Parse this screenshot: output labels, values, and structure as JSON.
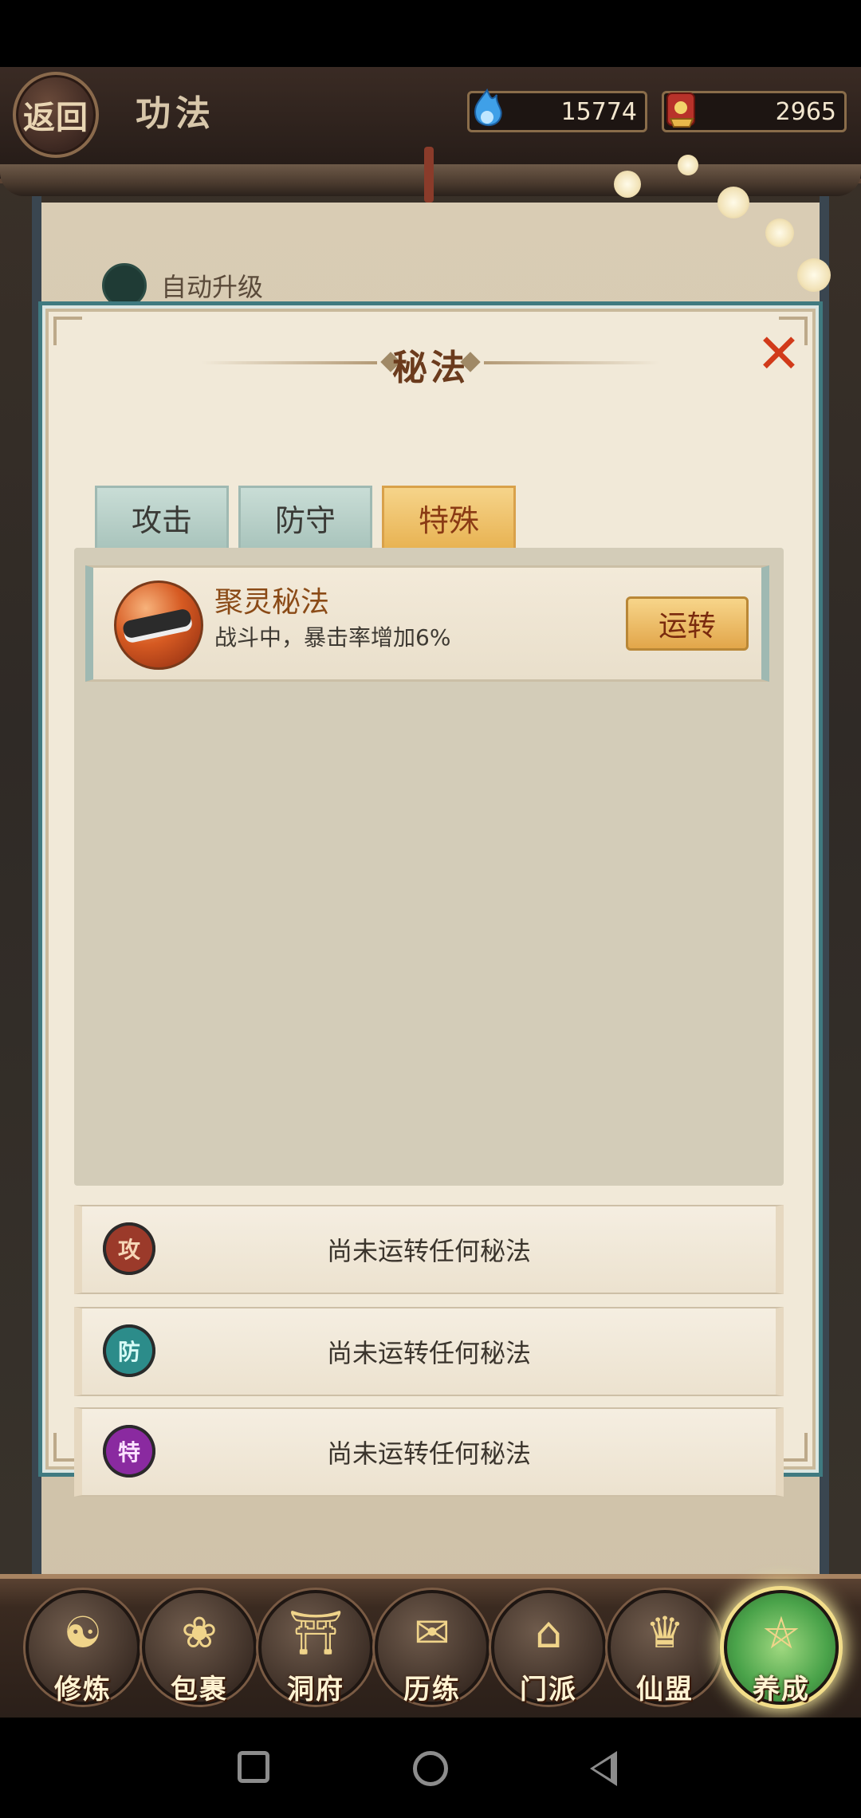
{
  "header": {
    "back_label": "返回",
    "title": "功法",
    "currencies": [
      {
        "icon": "spirit-flame-icon",
        "value": "15774"
      },
      {
        "icon": "gold-ingot-icon",
        "value": "2965"
      }
    ]
  },
  "background": {
    "auto_upgrade_label": "自动升级"
  },
  "modal": {
    "title": "秘法",
    "close_icon": "close-icon",
    "tabs": [
      {
        "label": "攻击",
        "active": false
      },
      {
        "label": "防守",
        "active": false
      },
      {
        "label": "特殊",
        "active": true
      }
    ],
    "skills": [
      {
        "name": "聚灵秘法",
        "description": "战斗中，暴击率增加6%",
        "action_label": "运转",
        "icon": "blade-skill-icon"
      }
    ],
    "slots": [
      {
        "icon_char": "攻",
        "icon_color": "#9b3a2a",
        "text": "尚未运转任何秘法"
      },
      {
        "icon_char": "防",
        "icon_color": "#2c8c8a",
        "text": "尚未运转任何秘法"
      },
      {
        "icon_char": "特",
        "icon_color": "#8a2aa0",
        "text": "尚未运转任何秘法"
      }
    ]
  },
  "bottom_nav": {
    "items": [
      {
        "label": "修炼",
        "icon": "cultivator-icon",
        "active": false
      },
      {
        "label": "包裹",
        "icon": "bag-icon",
        "active": false
      },
      {
        "label": "洞府",
        "icon": "cave-mansion-icon",
        "active": false
      },
      {
        "label": "历练",
        "icon": "scroll-icon",
        "active": false
      },
      {
        "label": "门派",
        "icon": "sect-gate-icon",
        "active": false
      },
      {
        "label": "仙盟",
        "icon": "alliance-crown-icon",
        "active": false
      },
      {
        "label": "养成",
        "icon": "pentagram-icon",
        "active": true
      }
    ]
  },
  "colors": {
    "accent_gold": "#e8b353",
    "tab_teal": "#a9c4bc",
    "modal_border": "#3f7a80"
  }
}
